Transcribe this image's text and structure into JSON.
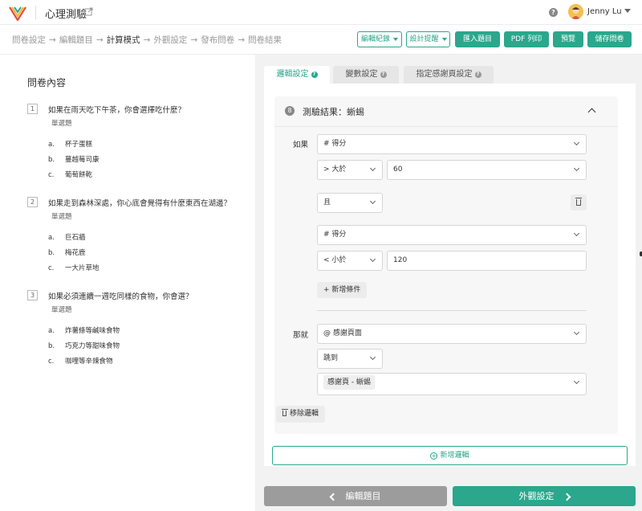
{
  "header": {
    "app_title": "心理測驗",
    "user_name": "Jenny Lu",
    "colors": {
      "brand": "#2aa78c",
      "logo_red": "#e0523b",
      "logo_yellow": "#f2b233"
    }
  },
  "stepbar": {
    "steps": [
      "問卷設定",
      "編輯題目",
      "計算模式",
      "外觀設定",
      "發布問卷",
      "問卷結果"
    ],
    "active_step": "計算模式",
    "buttons": {
      "edit_history": "編輯紀錄",
      "design_tips": "設計提醒",
      "import": "匯入題目",
      "pdf": "PDF 列印",
      "preview": "預覽",
      "save": "儲存問卷"
    }
  },
  "left": {
    "title": "問卷內容",
    "questions": [
      {
        "num": "1",
        "text": "如果在雨天吃下午茶，你會選擇吃什麼？",
        "type": "單選題",
        "options": [
          {
            "letter": "a.",
            "text": "杯子蛋糕"
          },
          {
            "letter": "b.",
            "text": "蔓越莓司康"
          },
          {
            "letter": "c.",
            "text": "葡萄餅乾"
          }
        ]
      },
      {
        "num": "2",
        "text": "如果走到森林深處，你心底會覺得有什麼東西在湖邊？",
        "type": "單選題",
        "options": [
          {
            "letter": "a.",
            "text": "巨石牆"
          },
          {
            "letter": "b.",
            "text": "梅花鹿"
          },
          {
            "letter": "c.",
            "text": "一大片草地"
          }
        ]
      },
      {
        "num": "3",
        "text": "如果必須連續一週吃同樣的食物，你會選？",
        "type": "單選題",
        "options": [
          {
            "letter": "a.",
            "text": "炸薯條等鹹味食物"
          },
          {
            "letter": "b.",
            "text": "巧克力等甜味食物"
          },
          {
            "letter": "c.",
            "text": "咖哩等辛辣食物"
          }
        ]
      }
    ]
  },
  "right": {
    "tabs": [
      "邏輯設定",
      "變數設定",
      "指定感謝頁設定"
    ],
    "active_tab": "邏輯設定",
    "rule": {
      "number": "8",
      "title": "測驗結果：蜥蜴",
      "if_label": "如果",
      "cond1_var": "# 得分",
      "cond1_op": "> 大於",
      "cond1_value": "60",
      "connector": "且",
      "cond2_var": "# 得分",
      "cond2_op": "< 小於",
      "cond2_value": "120",
      "add_condition": "+ 新增條件",
      "then_label": "那就",
      "action_target": "@ 感謝頁面",
      "action": "跳到",
      "thankyou_page": "感謝頁 - 蜥蜴",
      "remove_logic": "移除邏輯"
    },
    "add_logic": "新增邏輯",
    "prev_button": "編輯題目",
    "next_button": "外觀設定"
  }
}
